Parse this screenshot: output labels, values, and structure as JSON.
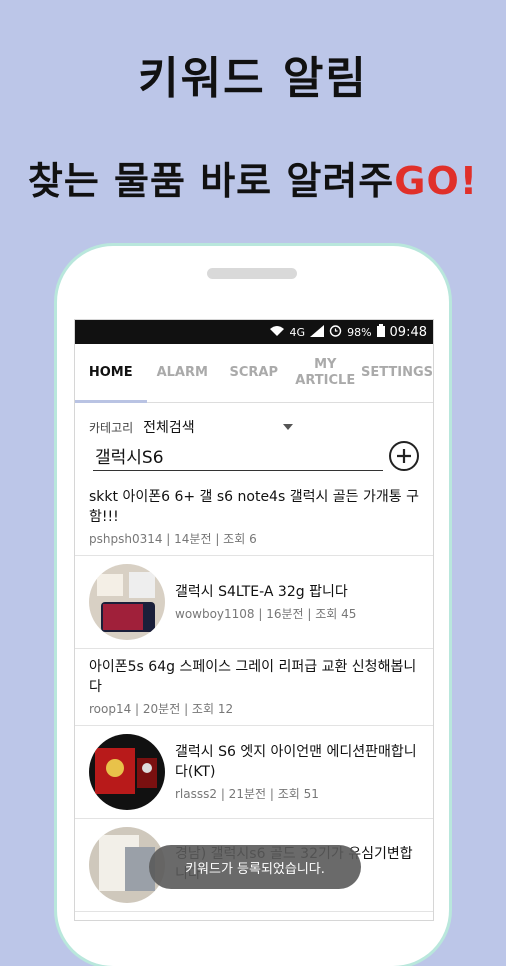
{
  "promo": {
    "title": "키워드 알림",
    "subtitle_main": "찾는 물품 바로 알려주",
    "subtitle_accent": "GO!",
    "accent_color": "#e0302a"
  },
  "statusbar": {
    "network": "4G",
    "battery": "98%",
    "time": "09:48"
  },
  "tabs": [
    {
      "label": "HOME"
    },
    {
      "label": "ALARM"
    },
    {
      "label": "SCRAP"
    },
    {
      "label": "MY ARTICLE"
    },
    {
      "label": "SETTINGS"
    }
  ],
  "filter": {
    "category_label": "카테고리",
    "category_value": "전체검색",
    "search_value": "갤럭시S6"
  },
  "items": [
    {
      "title": "skkt 아이폰6 6+ 갤 s6 note4s 갤럭시 골든 가개통 구함!!!",
      "meta": "pshpsh0314 | 14분전 | 조회 6"
    },
    {
      "title": "갤럭시 S4LTE-A 32g 팝니다",
      "meta": "wowboy1108 | 16분전 | 조회 45",
      "thumb": "phone-photo"
    },
    {
      "title": "아이폰5s 64g 스페이스 그레이 리퍼급 교환 신청해봅니다",
      "meta": "roop14 | 20분전 | 조회 12"
    },
    {
      "title": "갤럭시 S6 엣지 아이언맨 에디션판매합니다(KT)",
      "meta": "rlasss2 | 21분전 | 조회 51",
      "thumb": "ironman-box-photo"
    },
    {
      "title": "경남) 갤럭시s6 골드 32기가 유심기변합니다",
      "meta": "",
      "thumb": "gold-phone-photo"
    }
  ],
  "toast": "키워드가 등록되었습니다."
}
